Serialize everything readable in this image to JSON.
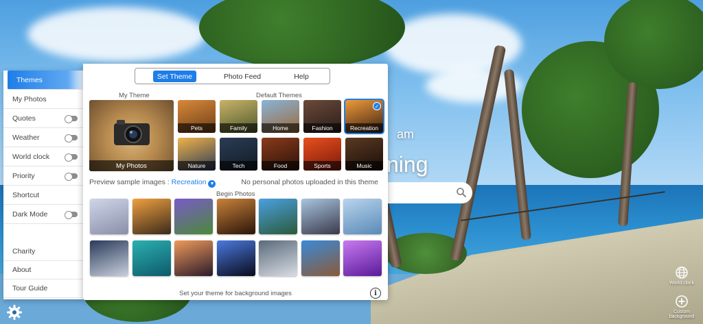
{
  "background": {
    "greeting_partial": "am",
    "headline_partial": "ning"
  },
  "sidebar": {
    "items": [
      {
        "label": "Themes",
        "active": true,
        "toggle": false
      },
      {
        "label": "My Photos",
        "active": false,
        "toggle": false
      },
      {
        "label": "Quotes",
        "active": false,
        "toggle": true
      },
      {
        "label": "Weather",
        "active": false,
        "toggle": true
      },
      {
        "label": "World clock",
        "active": false,
        "toggle": true
      },
      {
        "label": "Priority",
        "active": false,
        "toggle": true
      },
      {
        "label": "Shortcut",
        "active": false,
        "toggle": false
      },
      {
        "label": "Dark Mode",
        "active": false,
        "toggle": true
      },
      {
        "label": "Charity",
        "active": false,
        "toggle": false
      },
      {
        "label": "About",
        "active": false,
        "toggle": false
      },
      {
        "label": "Tour Guide",
        "active": false,
        "toggle": false
      }
    ]
  },
  "panel": {
    "tabs": [
      {
        "label": "Set Theme",
        "active": true
      },
      {
        "label": "Photo Feed",
        "active": false
      },
      {
        "label": "Help",
        "active": false
      }
    ],
    "my_theme_label": "My Theme",
    "default_themes_label": "Default Themes",
    "my_photos_label": "My Photos",
    "themes": [
      {
        "label": "Pets",
        "selected": false,
        "colors": [
          "#d9893a",
          "#6d3f18"
        ]
      },
      {
        "label": "Family",
        "selected": false,
        "colors": [
          "#c9b26a",
          "#4d5a2a"
        ]
      },
      {
        "label": "Home",
        "selected": false,
        "colors": [
          "#8ab3d8",
          "#9a6a3a"
        ]
      },
      {
        "label": "Fashion",
        "selected": false,
        "colors": [
          "#6b4a3a",
          "#2a1d18"
        ]
      },
      {
        "label": "Recreation",
        "selected": true,
        "colors": [
          "#f19a3a",
          "#3b2212"
        ]
      },
      {
        "label": "Nature",
        "selected": false,
        "colors": [
          "#f0b347",
          "#2b3a5a"
        ]
      },
      {
        "label": "Tech",
        "selected": false,
        "colors": [
          "#2a3d55",
          "#121a24"
        ]
      },
      {
        "label": "Food",
        "selected": false,
        "colors": [
          "#8a3b1a",
          "#2a120a"
        ]
      },
      {
        "label": "Sports",
        "selected": false,
        "colors": [
          "#e8501c",
          "#7a1a0c"
        ]
      },
      {
        "label": "Music",
        "selected": false,
        "colors": [
          "#5a3a22",
          "#1a0e08"
        ]
      }
    ],
    "preview_label": "Preview sample images :",
    "preview_value": "Recreation",
    "no_photos_text": "No personal photos uploaded in this theme",
    "begin_photos_label": "Begin Photos",
    "photos": [
      {
        "colors": [
          "#cfd6e8",
          "#8a8fa8"
        ]
      },
      {
        "colors": [
          "#f0a040",
          "#3a2a1a"
        ]
      },
      {
        "colors": [
          "#7a5ac8",
          "#4a8a3a"
        ]
      },
      {
        "colors": [
          "#c8823a",
          "#2a1408"
        ]
      },
      {
        "colors": [
          "#4aa0e0",
          "#2a5a3a"
        ]
      },
      {
        "colors": [
          "#a8c4e0",
          "#3a3a4a"
        ]
      },
      {
        "colors": [
          "#b8d4ec",
          "#5a8ab8"
        ]
      },
      {
        "colors": [
          "#2a3a5a",
          "#c8d0dc"
        ]
      },
      {
        "colors": [
          "#2ab0b0",
          "#0e5a6a"
        ]
      },
      {
        "colors": [
          "#f09a5a",
          "#2a1a2a"
        ]
      },
      {
        "colors": [
          "#4a7ae0",
          "#0a0a1a"
        ]
      },
      {
        "colors": [
          "#5a6a7a",
          "#d8dce4"
        ]
      },
      {
        "colors": [
          "#3a8ad8",
          "#8a5a3a"
        ]
      },
      {
        "colors": [
          "#c87af0",
          "#5a1a9a"
        ]
      }
    ],
    "footer_text": "Set your theme for background images"
  },
  "widgets": {
    "world_clock_label": "World clock",
    "custom_background_label": "Custom background"
  },
  "colors": {
    "accent": "#1e7ee8"
  }
}
